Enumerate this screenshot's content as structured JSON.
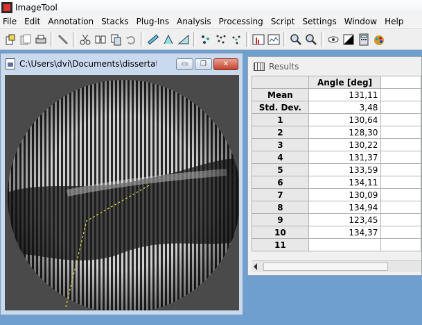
{
  "app": {
    "title": "ImageTool"
  },
  "menu": [
    "File",
    "Edit",
    "Annotation",
    "Stacks",
    "Plug-Ins",
    "Analysis",
    "Processing",
    "Script",
    "Settings",
    "Window",
    "Help"
  ],
  "toolbar": {
    "icons": [
      "new-icon",
      "open-icon",
      "print-icon",
      "line-tool-icon",
      "cut-icon",
      "paste-icon",
      "copy-icon",
      "undo-icon",
      "ruler-icon",
      "angle-icon",
      "triangle-icon",
      "points-icon",
      "scatter-icon",
      "cluster-icon",
      "histogram-icon",
      "profile-icon",
      "zoom-in-icon",
      "zoom-out-icon",
      "eye-icon",
      "contrast-icon",
      "calculator-icon",
      "palette-icon"
    ]
  },
  "image_window": {
    "title": "C:\\Users\\dvi\\Documents\\dissertation\\...",
    "minimize": "▭",
    "restore": "❐",
    "close": "✕"
  },
  "results_window": {
    "title": "Results",
    "column_header": "Angle [deg]",
    "rows": [
      {
        "label": "Mean",
        "value": "131,11"
      },
      {
        "label": "Std. Dev.",
        "value": "3,48"
      },
      {
        "label": "1",
        "value": "130,64"
      },
      {
        "label": "2",
        "value": "128,30"
      },
      {
        "label": "3",
        "value": "130,22"
      },
      {
        "label": "4",
        "value": "131,37"
      },
      {
        "label": "5",
        "value": "133,59"
      },
      {
        "label": "6",
        "value": "134,11"
      },
      {
        "label": "7",
        "value": "130,09"
      },
      {
        "label": "8",
        "value": "134,94"
      },
      {
        "label": "9",
        "value": "123,45"
      },
      {
        "label": "10",
        "value": "134,37"
      },
      {
        "label": "11",
        "value": ""
      }
    ]
  }
}
